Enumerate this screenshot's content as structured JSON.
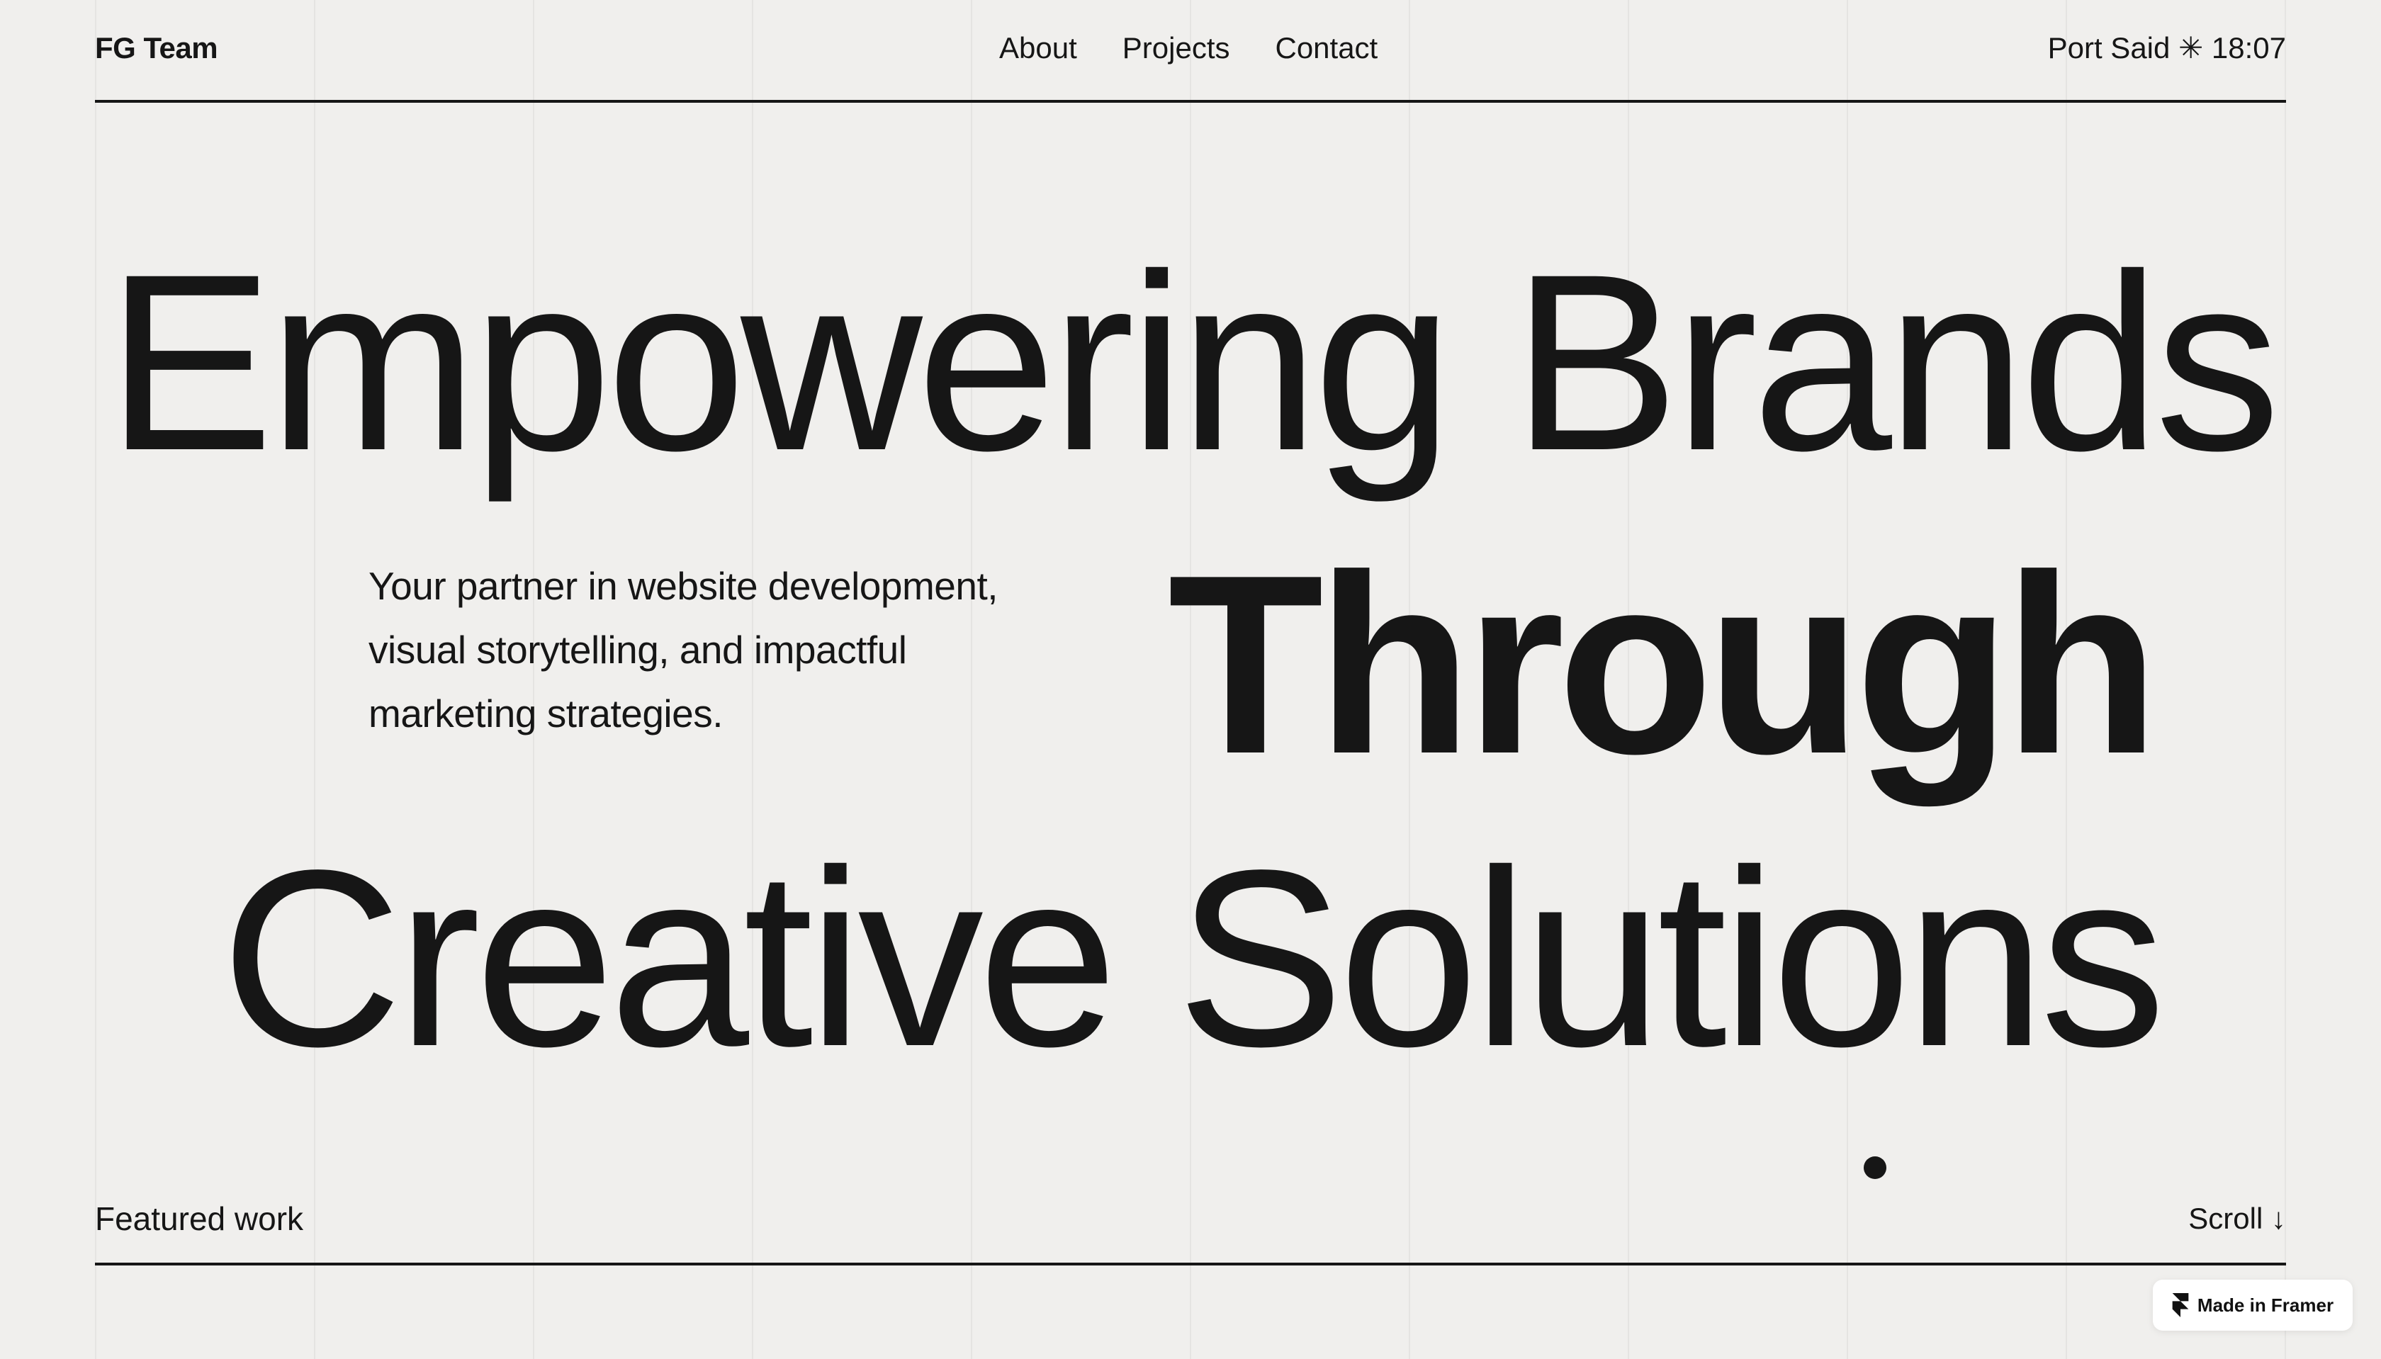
{
  "header": {
    "brand": "FG Team",
    "nav": [
      "About",
      "Projects",
      "Contact"
    ],
    "location": "Port Said ✳ 18:07"
  },
  "hero": {
    "line1": "Empowering Brands",
    "line2": "Through",
    "line3": "Creative Solutions",
    "tagline": "Your partner in website development, visual storytelling, and impactful marketing strategies."
  },
  "section": {
    "featured_label": "Featured work",
    "scroll_label": "Scroll ↓"
  },
  "badge": {
    "label": "Made in Framer",
    "icon": "framer-logo-icon"
  },
  "colors": {
    "background": "#f0efed",
    "text": "#161616",
    "badge_bg": "#ffffff"
  }
}
